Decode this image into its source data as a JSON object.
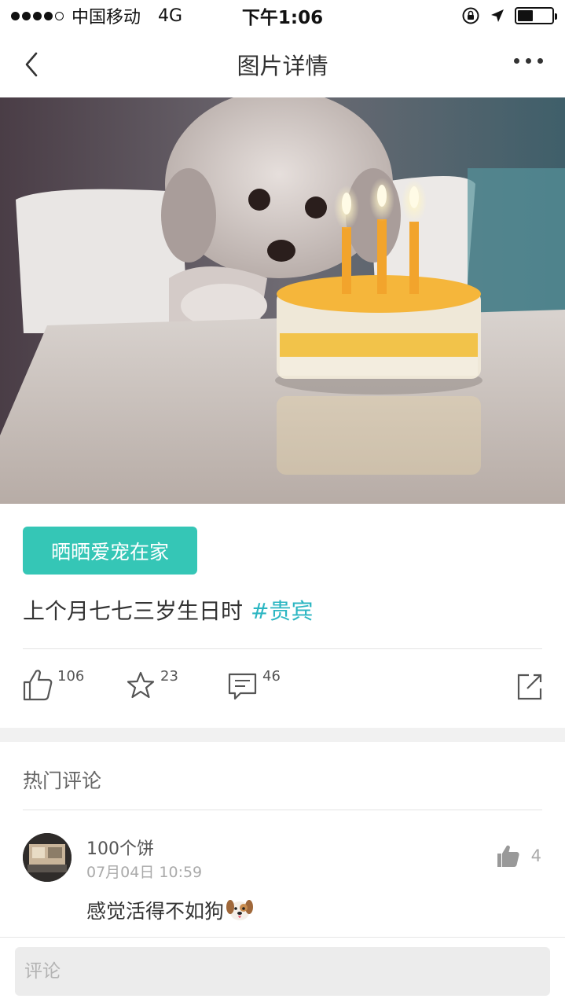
{
  "status_bar": {
    "carrier": "中国移动",
    "network": "4G",
    "time": "下午1:06",
    "battery_level": 0.45
  },
  "nav": {
    "title": "图片详情",
    "back_icon": "chevron-left-icon",
    "more_icon": "more-dots-icon"
  },
  "post": {
    "tag_label": "晒晒爱宠在家",
    "caption": "上个月七七三岁生日时",
    "hashtag": "#贵宾",
    "likes": "106",
    "favorites": "23",
    "comments": "46"
  },
  "hot_comments": {
    "title": "热门评论",
    "items": [
      {
        "user": "100个饼",
        "time": "07月04日 10:59",
        "text": "感觉活得不如狗",
        "likes": "4"
      }
    ]
  },
  "input": {
    "placeholder": "评论"
  },
  "colors": {
    "accent": "#35c6b6",
    "hashtag": "#2bb6c2"
  }
}
